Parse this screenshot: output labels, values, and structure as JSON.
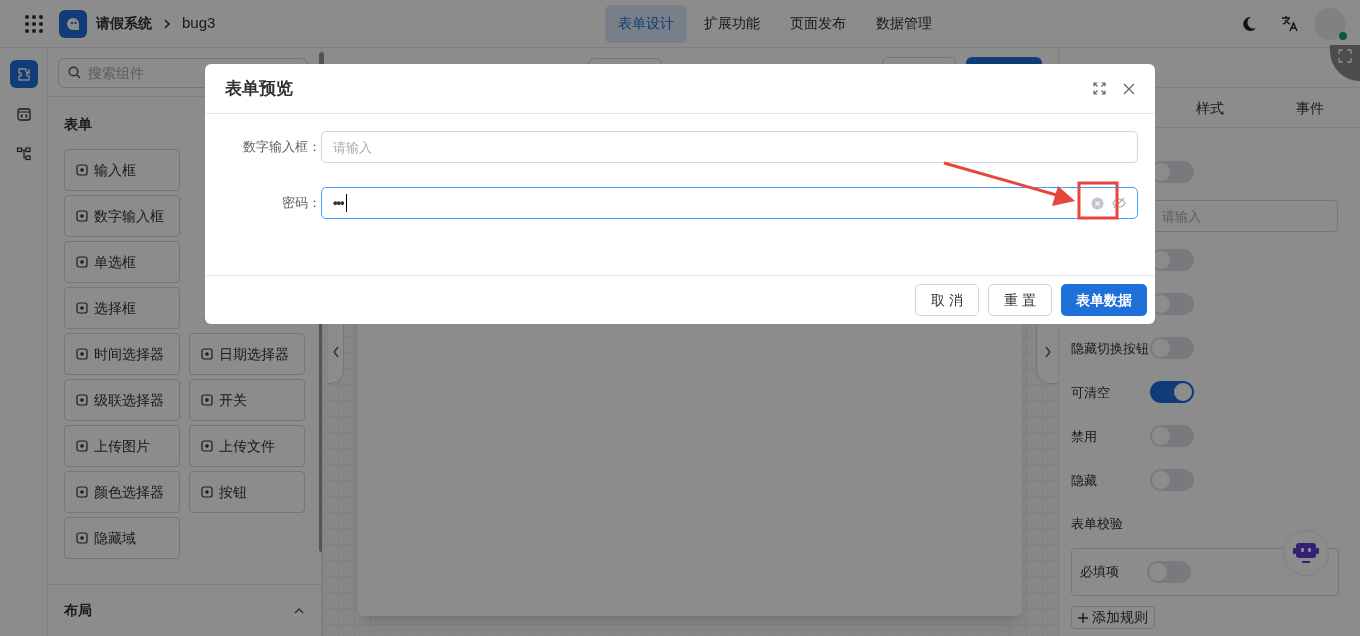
{
  "top_bar": {
    "app_name": "请假系统",
    "page": "bug3",
    "tabs": [
      {
        "label": "表单设计",
        "selected": true
      },
      {
        "label": "扩展功能",
        "selected": false
      },
      {
        "label": "页面发布",
        "selected": false
      },
      {
        "label": "数据管理",
        "selected": false
      }
    ]
  },
  "sidebar_rail": [
    {
      "selected": true
    },
    {
      "selected": false
    },
    {
      "selected": false
    }
  ],
  "component_panel": {
    "search_placeholder": "搜索组件",
    "section": "表单",
    "rows": [
      [
        "输入框"
      ],
      [
        "数字输入框"
      ],
      [
        "单选框"
      ],
      [
        "选择框"
      ],
      [
        "时间选择器",
        "日期选择器"
      ],
      [
        "级联选择器",
        "开关"
      ],
      [
        "上传图片",
        "上传文件"
      ],
      [
        "颜色选择器",
        "按钮"
      ],
      [
        "隐藏域"
      ]
    ],
    "layout_section": {
      "label": "布局",
      "expanded": true
    }
  },
  "properties_panel": {
    "tabs": [
      {
        "label": "样式",
        "selected": false
      },
      {
        "label": "事件",
        "selected": false
      }
    ],
    "rows": [
      {
        "kind": "toggle",
        "on": false
      },
      {
        "kind": "input",
        "placeholder": "请输入"
      },
      {
        "kind": "toggle",
        "on": false
      },
      {
        "kind": "toggle",
        "on": false
      },
      {
        "kind": "toggle",
        "label": "隐藏切换按钮",
        "on": false
      },
      {
        "kind": "toggle",
        "label": "可清空",
        "on": true
      },
      {
        "kind": "toggle",
        "label": "禁用",
        "on": false
      },
      {
        "kind": "toggle",
        "label": "隐藏",
        "on": false
      },
      {
        "kind": "heading",
        "label": "表单校验"
      }
    ],
    "validation": {
      "label": "必填项",
      "on": false
    },
    "add_rule": "添加规则"
  },
  "modal": {
    "title": "表单预览",
    "fields": [
      {
        "label": "数字输入框：",
        "placeholder": "请输入",
        "focused": false
      },
      {
        "label": "密码：",
        "value": "•••",
        "focused": true,
        "clearable": true,
        "password_toggle": true
      }
    ],
    "buttons": [
      {
        "label": "取 消",
        "primary": false
      },
      {
        "label": "重 置",
        "primary": false
      },
      {
        "label": "表单数据",
        "primary": true
      }
    ]
  },
  "annotation": {
    "color": "#e8453c"
  }
}
